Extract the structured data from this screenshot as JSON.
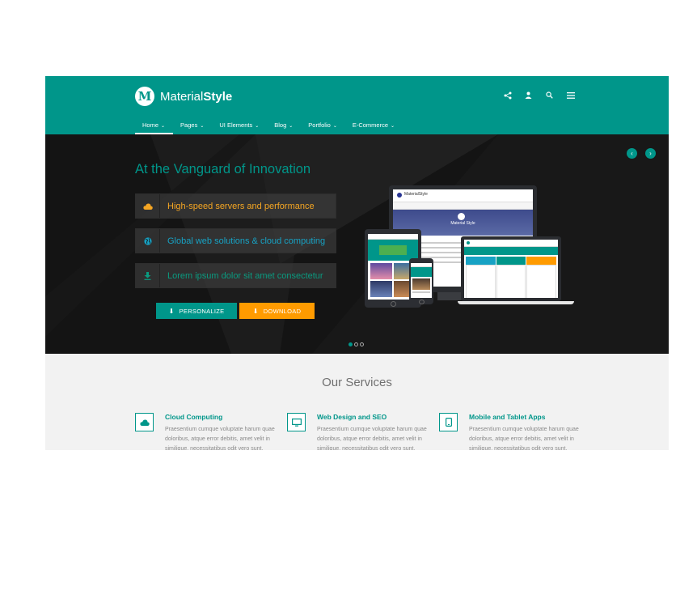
{
  "brand": {
    "initial": "M",
    "name_light": "Material",
    "name_bold": "Style"
  },
  "header_icons": [
    "share-icon",
    "user-icon",
    "search-icon",
    "menu-icon"
  ],
  "nav": [
    {
      "label": "Home"
    },
    {
      "label": "Pages"
    },
    {
      "label": "UI Elements"
    },
    {
      "label": "Blog"
    },
    {
      "label": "Portfolio"
    },
    {
      "label": "E-Commerce"
    }
  ],
  "hero": {
    "title": "At the Vanguard of Innovation",
    "features": [
      {
        "icon": "cloud-icon",
        "text": "High-speed servers and performance"
      },
      {
        "icon": "globe-icon",
        "text": "Global web solutions & cloud computing"
      },
      {
        "icon": "download-icon",
        "text": "Lorem ipsum dolor sit amet consectetur"
      }
    ],
    "buttons": {
      "personalize": "PERSONALIZE",
      "download": "DOWNLOAD"
    },
    "mock_brand": "MaterialStyle",
    "mock_hero_title": "Material Style"
  },
  "colors": {
    "primary": "#00968a",
    "accent": "#ff9b00",
    "hero_bg": "#141414"
  },
  "services": {
    "title": "Our Services",
    "items": [
      {
        "icon": "cloud-icon",
        "title": "Cloud Computing",
        "text": "Praesentium cumque voluptate harum quae doloribus, atque error debitis, amet velit in similique, necessitatibus odit vero sunt."
      },
      {
        "icon": "monitor-icon",
        "title": "Web Design and SEO",
        "text": "Praesentium cumque voluptate harum quae doloribus, atque error debitis, amet velit in similique, necessitatibus odit vero sunt."
      },
      {
        "icon": "tablet-icon",
        "title": "Mobile and Tablet Apps",
        "text": "Praesentium cumque voluptate harum quae doloribus, atque error debitis, amet velit in similique, necessitatibus odit vero sunt."
      }
    ]
  }
}
